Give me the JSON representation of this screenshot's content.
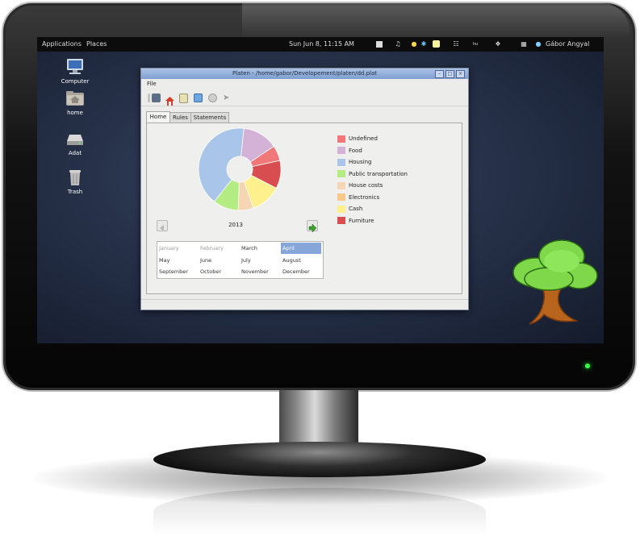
{
  "topbar": {
    "applications": "Applications",
    "places": "Places",
    "clock": "Sun Jun  8, 11:15 AM",
    "user": "Gábor Angyal",
    "tray_icons": [
      "network-icon",
      "volume-icon",
      "bluetooth-icon",
      "wifi-icon"
    ]
  },
  "desktop": {
    "icons": [
      {
        "label": "Computer",
        "icon": "computer-icon"
      },
      {
        "label": "home",
        "icon": "home-folder-icon"
      },
      {
        "label": "Adat",
        "icon": "drive-icon"
      },
      {
        "label": "Trash",
        "icon": "trash-icon"
      }
    ]
  },
  "window": {
    "title": "Platen - /home/gabor/Developement/platen/dd.plat",
    "menu": {
      "file": "File"
    },
    "toolbar": [
      "save-icon",
      "home-icon",
      "document-icon",
      "edit-icon",
      "settings-icon",
      "forward-icon"
    ],
    "tabs": [
      "Home",
      "Rules",
      "Statements"
    ],
    "active_tab": "Home",
    "year": "2013",
    "months": [
      "January",
      "February",
      "March",
      "April",
      "May",
      "June",
      "July",
      "August",
      "September",
      "October",
      "November",
      "December"
    ],
    "selected_month": "April",
    "dimmed_months": [
      "January",
      "February"
    ]
  },
  "chart_data": {
    "type": "pie",
    "style": "donut",
    "title": "",
    "slices": [
      {
        "label": "Undefined",
        "value": 6,
        "color": "#f07878"
      },
      {
        "label": "Food",
        "value": 14,
        "color": "#d4b2d8"
      },
      {
        "label": "Housing",
        "value": 41,
        "color": "#a9c6ea"
      },
      {
        "label": "Public transportation",
        "value": 10,
        "color": "#b4ec84"
      },
      {
        "label": "House costs",
        "value": 6,
        "color": "#f6d6b2"
      },
      {
        "label": "Electronics",
        "value": 0,
        "color": "#f8c88a"
      },
      {
        "label": "Cash",
        "value": 12,
        "color": "#fef08c"
      },
      {
        "label": "Furniture",
        "value": 11,
        "color": "#d84e50"
      }
    ]
  },
  "colors": {
    "accent": "#86a5d8",
    "titlebar": "#94b0dc",
    "led": "#36ff4a",
    "tree_leaves": "#7ed84a",
    "tree_trunk": "#b8641c"
  }
}
